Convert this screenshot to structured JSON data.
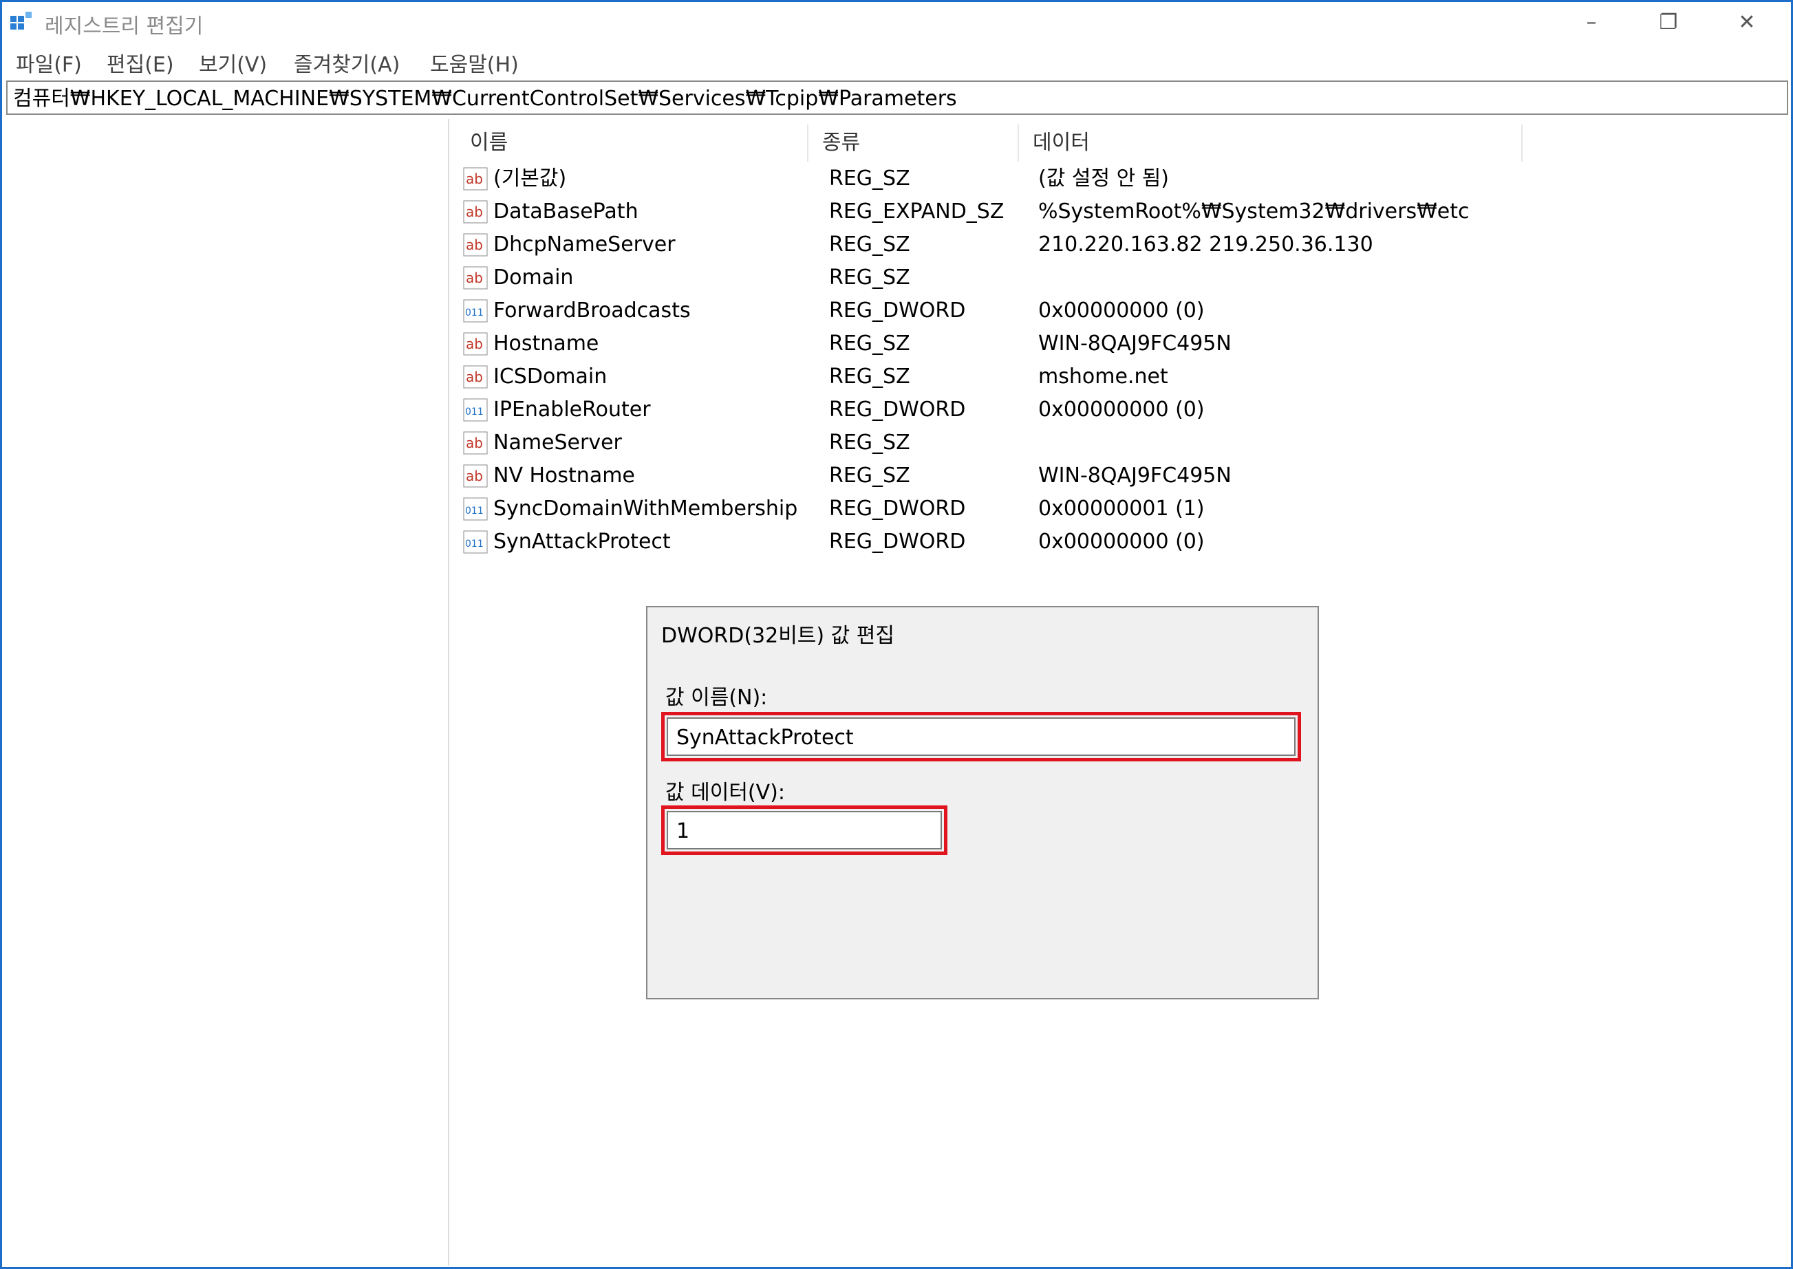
{
  "window": {
    "title": "레지스트리 편집기"
  },
  "menu": [
    "파일(F)",
    "편집(E)",
    "보기(V)",
    "즐겨찾기(A)",
    "도움말(H)"
  ],
  "address": "컴퓨터₩HKEY_LOCAL_MACHINE₩SYSTEM₩CurrentControlSet₩Services₩Tcpip₩Parameters",
  "columns": [
    "이름",
    "종류",
    "데이터"
  ],
  "values": [
    {
      "name": "(기본값)",
      "type": "REG_SZ",
      "data": "(값 설정 안 됨)",
      "icon": "string-icon"
    },
    {
      "name": "DataBasePath",
      "type": "REG_EXPAND_SZ",
      "data": "%SystemRoot%₩System32₩drivers₩etc",
      "icon": "string-icon"
    },
    {
      "name": "DhcpNameServer",
      "type": "REG_SZ",
      "data": "210.220.163.82 219.250.36.130",
      "icon": "string-icon"
    },
    {
      "name": "Domain",
      "type": "REG_SZ",
      "data": "",
      "icon": "string-icon"
    },
    {
      "name": "ForwardBroadcasts",
      "type": "REG_DWORD",
      "data": "0x00000000 (0)",
      "icon": "binary-icon"
    },
    {
      "name": "Hostname",
      "type": "REG_SZ",
      "data": "WIN-8QAJ9FC495N",
      "icon": "string-icon"
    },
    {
      "name": "ICSDomain",
      "type": "REG_SZ",
      "data": "mshome.net",
      "icon": "string-icon"
    },
    {
      "name": "IPEnableRouter",
      "type": "REG_DWORD",
      "data": "0x00000000 (0)",
      "icon": "binary-icon"
    },
    {
      "name": "NameServer",
      "type": "REG_SZ",
      "data": "",
      "icon": "string-icon"
    },
    {
      "name": "NV Hostname",
      "type": "REG_SZ",
      "data": "WIN-8QAJ9FC495N",
      "icon": "string-icon"
    },
    {
      "name": "SyncDomainWithMembership",
      "type": "REG_DWORD",
      "data": "0x00000001 (1)",
      "icon": "binary-icon"
    },
    {
      "name": "SynAttackProtect",
      "type": "REG_DWORD",
      "data": "0x00000000 (0)",
      "icon": "binary-icon"
    }
  ],
  "dialog": {
    "title": "DWORD(32비트) 값 편집",
    "name_label": "값 이름(N):",
    "name_value": "SynAttackProtect",
    "data_label": "값 데이터(V):",
    "data_value": "1"
  },
  "colors": {
    "accent": "#1c6ec8",
    "highlight": "#e0141e"
  }
}
